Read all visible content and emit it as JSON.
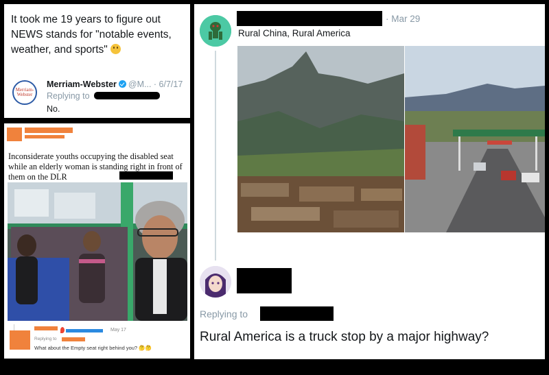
{
  "tweet1": {
    "text": "It took me 19 years to figure out NEWS stands for \"notable events, weather, and sports\"",
    "emoji_icon": "thinking-face-emoji",
    "reply": {
      "logo_text": "Merriam-Webster",
      "name": "Merriam-Webster",
      "verified_icon": "verified-badge-icon",
      "handle": "@M...",
      "date": "· 6/7/17",
      "replying_to": "Replying to",
      "text": "No."
    }
  },
  "tweet2": {
    "caption": "Inconsiderate youths occupying the disabled seat while an elderly woman is standing right in front of them on the DLR",
    "reply": {
      "date": "May 17",
      "replying_to": "Replying to",
      "text": "What about the Empty seat right behind you? 🤔🤔"
    }
  },
  "tweet3": {
    "date": "· Mar 29",
    "text": "Rural China, Rural America",
    "reply": {
      "replying_to": "Replying to",
      "text": "Rural America is a truck stop by a major highway?"
    }
  },
  "colors": {
    "twitter_blue": "#1da1f2",
    "secondary_text": "#8899a6",
    "redaction": "#000000",
    "orange_bar": "#f0823c"
  }
}
